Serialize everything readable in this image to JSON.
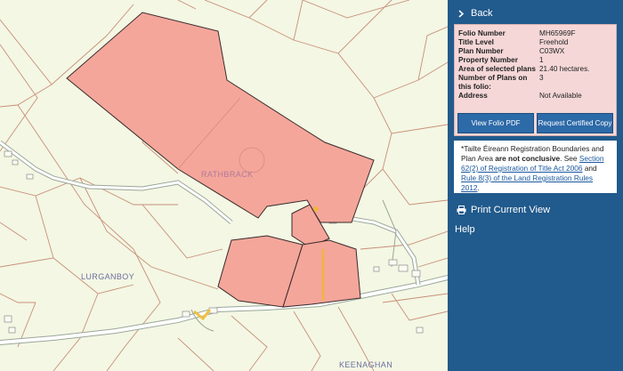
{
  "map": {
    "labels": {
      "rathbrack": "RATHBRACK",
      "lurganboy": "LURGANBOY",
      "keenaghan": "KEENAGHAN"
    },
    "colors": {
      "background": "#f3f7e3",
      "parcel_fill": "#f4a69a",
      "parcel_border": "#3a2a2a",
      "boundary_line": "#c98f7a",
      "road_fill": "#ffffff",
      "road_edge": "#9aa79a",
      "track_highlight": "#f0b540"
    }
  },
  "sidebar": {
    "back_label": "Back",
    "back_icon": "chevron-right-icon",
    "folio": {
      "rows": [
        {
          "key": "Folio Number",
          "value": "MH65969F"
        },
        {
          "key": "Title Level",
          "value": "Freehold"
        },
        {
          "key": "Plan Number",
          "value": "C03WX"
        },
        {
          "key": "Property Number",
          "value": "1"
        },
        {
          "key": "Area of selected plans",
          "value": "21.40 hectares."
        },
        {
          "key": "Number of Plans on this folio:",
          "value": "3"
        },
        {
          "key": "Address",
          "value": "Not Available"
        }
      ],
      "view_pdf_label": "View Folio PDF",
      "request_copy_label": "Request Certified Copy"
    },
    "disclaimer": {
      "prefix": "*Tailte Éireann Registration Boundaries and Plan Area ",
      "bold": "are not conclusive",
      "mid1": ". See ",
      "link1": "Section 62(2) of Registration of Title Act 2006",
      "mid2": " and ",
      "link2": "Rule 8(3) of the Land Registration Rules 2012",
      "suffix": "."
    },
    "print_label": "Print Current View",
    "print_icon": "printer-icon",
    "help_label": "Help",
    "colors": {
      "panel": "#215a8c",
      "card": "#f5d7d7",
      "button": "#2d6aa8"
    }
  }
}
